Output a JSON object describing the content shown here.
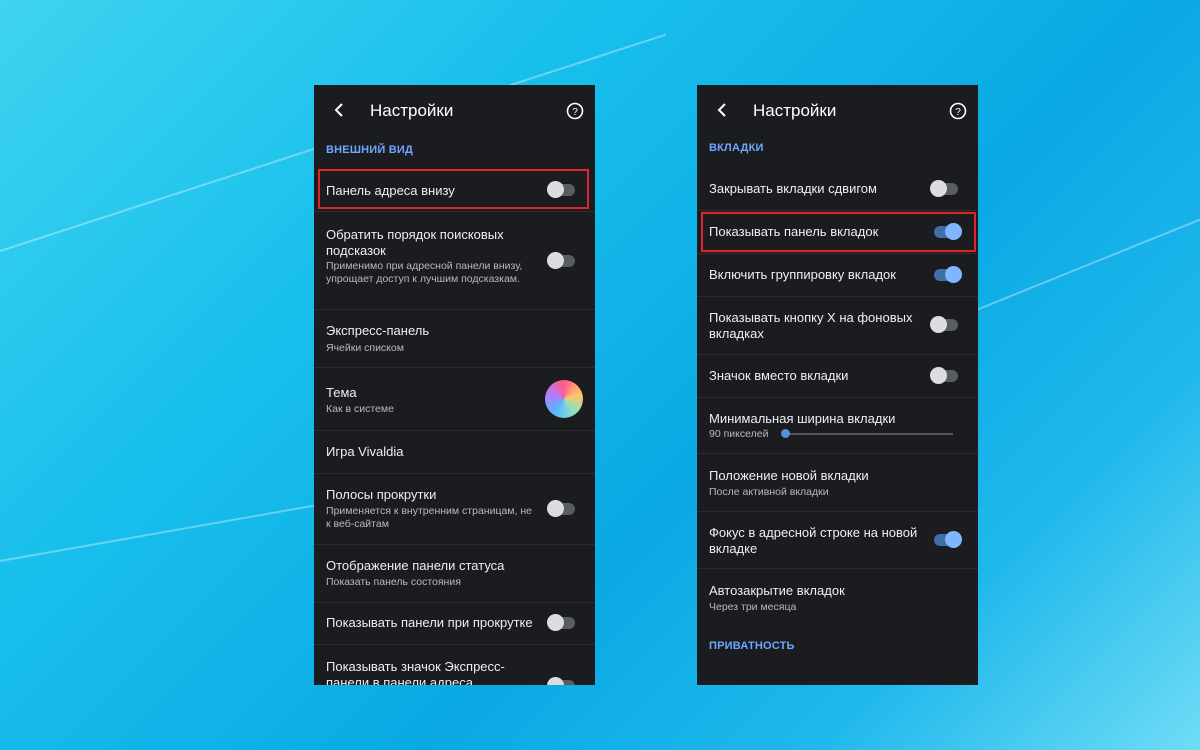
{
  "left_screen": {
    "title": "Настройки",
    "section": "ВНЕШНИЙ ВИД",
    "items": [
      {
        "title": "Панель адреса внизу",
        "toggle": false,
        "highlighted": true
      },
      {
        "title": "Обратить порядок поисковых подсказок",
        "subtitle": "Применимо при адресной панели внизу, упрощает доступ к лучшим подсказкам.",
        "toggle": false
      },
      {
        "title": "Экспресс-панель",
        "subtitle": "Ячейки списком"
      },
      {
        "title": "Тема",
        "subtitle": "Как в системе"
      },
      {
        "title": "Игра Vivaldia"
      },
      {
        "title": "Полосы прокрутки",
        "subtitle": "Применяется к внутренним страницам, не к веб-сайтам",
        "toggle": false
      },
      {
        "title": "Отображение панели статуса",
        "subtitle": "Показать панель состояния"
      },
      {
        "title": "Показывать панели при прокрутке",
        "toggle": false
      },
      {
        "title": "Показывать значок Экспресс-панели в панели адреса",
        "toggle": false
      }
    ]
  },
  "right_screen": {
    "title": "Настройки",
    "section": "ВКЛАДКИ",
    "items": [
      {
        "title": "Закрывать вкладки сдвигом",
        "toggle": false
      },
      {
        "title": "Показывать панель вкладок",
        "toggle": true,
        "highlighted": true
      },
      {
        "title": "Включить группировку вкладок",
        "toggle": true
      },
      {
        "title": "Показывать кнопку X на фоновых вкладках",
        "toggle": false
      },
      {
        "title": "Значок вместо вкладки",
        "toggle": false
      },
      {
        "title": "Минимальная ширина вкладки",
        "subtitle": "90 пикселей",
        "slider_fraction": 0.0
      },
      {
        "title": "Положение новой вкладки",
        "subtitle": "После активной вкладки"
      },
      {
        "title": "Фокус в адресной строке на новой вкладке",
        "toggle": true
      },
      {
        "title": "Автозакрытие вкладок",
        "subtitle": "Через три месяца"
      }
    ],
    "section2": "ПРИВАТНОСТЬ"
  },
  "icons": [
    "back-arrow-icon",
    "help-circle-icon"
  ],
  "colors": {
    "accent": "#6fa6ff",
    "highlight": "#e0242c",
    "panel": "#1b1c20"
  }
}
